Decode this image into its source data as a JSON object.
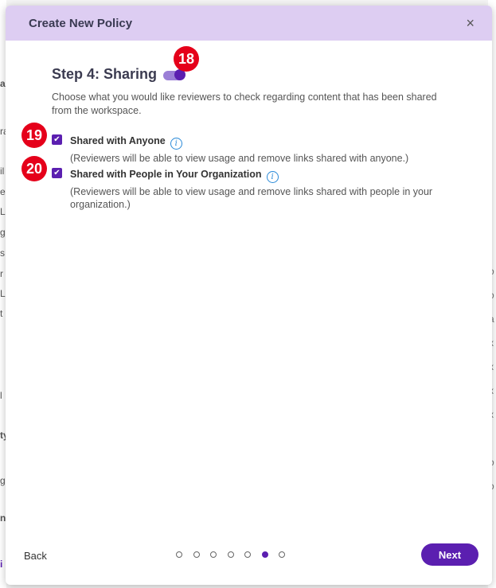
{
  "modal": {
    "title": "Create New Policy",
    "close_label": "×"
  },
  "step": {
    "title": "Step 4: Sharing",
    "toggle_on": true,
    "description": "Choose what you would like reviewers to check regarding content that has been shared from the workspace."
  },
  "options": [
    {
      "label": "Shared with Anyone",
      "checked": true,
      "sub": "(Reviewers will be able to view usage and remove links shared with anyone.)"
    },
    {
      "label": "Shared with People in Your Organization",
      "checked": true,
      "sub": "(Reviewers will be able to view usage and remove links shared with people in your organization.)"
    }
  ],
  "annotations": {
    "toggle": "18",
    "option1": "19",
    "option2": "20"
  },
  "footer": {
    "back_label": "Back",
    "next_label": "Next",
    "steps_total": 7,
    "current_step": 6
  },
  "background": {
    "left_fragments": [
      "al",
      "ra",
      "il",
      "e",
      "L",
      "g",
      "s",
      "r",
      "L",
      "t",
      "l",
      "ty",
      "g",
      "n",
      "i"
    ],
    "right_fragments": [
      "i",
      "o",
      "o",
      "a",
      "x",
      "x",
      "x",
      "x",
      "o",
      "o"
    ]
  },
  "colors": {
    "accent": "#5b1fb0",
    "header_bg": "#ddcdf2",
    "badge": "#e5001a",
    "info": "#2a8ad8"
  }
}
